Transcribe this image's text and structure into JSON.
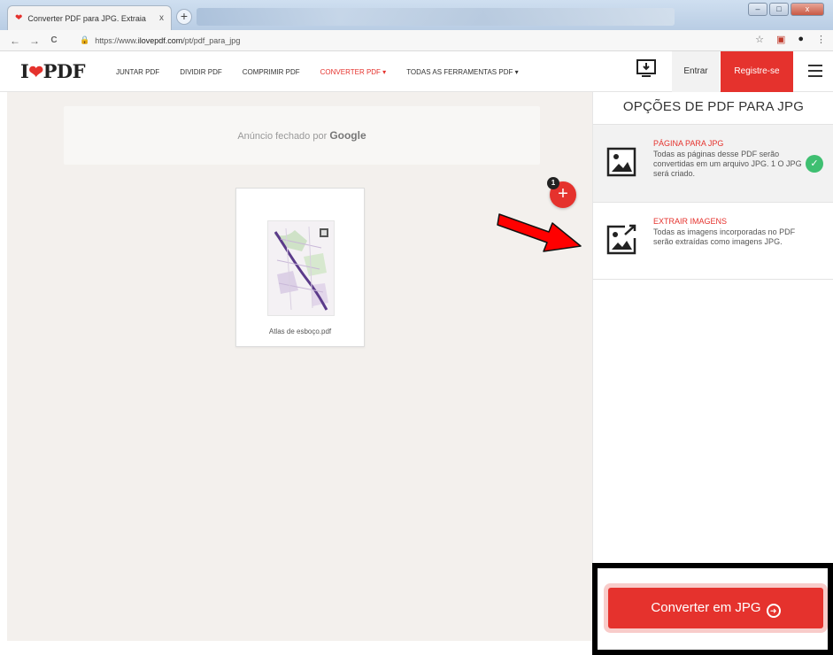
{
  "browser": {
    "tab_title": "Converter PDF para JPG. Extraia",
    "tab_close": "x",
    "new_tab": "+",
    "url_prefix": "https://www.",
    "url_domain": "ilovepdf.com",
    "url_path": "/pt/pdf_para_jpg",
    "back_icon": "←",
    "forward_icon": "→",
    "reload_icon": "C",
    "star_icon": "☆",
    "menu_icon": "⋮"
  },
  "header": {
    "logo_left": "I",
    "logo_right": "PDF",
    "nav": [
      {
        "label": "JUNTAR PDF"
      },
      {
        "label": "DIVIDIR PDF"
      },
      {
        "label": "COMPRIMIR PDF"
      },
      {
        "label": "CONVERTER PDF ▾"
      },
      {
        "label": "TODAS AS FERRAMENTAS PDF ▾"
      }
    ],
    "login": "Entrar",
    "signup": "Registre-se"
  },
  "workspace": {
    "ad_text": "Anúncio fechado por ",
    "ad_brand": "Google",
    "file_name": "Atlas de esboço.pdf",
    "file_count_badge": "1",
    "add_symbol": "+"
  },
  "sidebar": {
    "title": "OPÇÕES DE PDF PARA JPG",
    "options": [
      {
        "title": "PÁGINA PARA JPG",
        "description": "Todas as páginas desse PDF serão convertidas em um arquivo JPG. 1 O JPG será criado.",
        "icon": "image-page-icon",
        "selected": true
      },
      {
        "title": "EXTRAIR IMAGENS",
        "description": "Todas as imagens incorporadas no PDF serão extraídas como imagens JPG.",
        "icon": "extract-image-icon",
        "selected": false
      }
    ],
    "check_mark": "✓",
    "convert_button": "Converter em JPG",
    "convert_arrow": "➜"
  },
  "colors": {
    "brand_red": "#e5322d",
    "check_green": "#3fbf71",
    "workspace_bg": "#f3f0ed"
  }
}
